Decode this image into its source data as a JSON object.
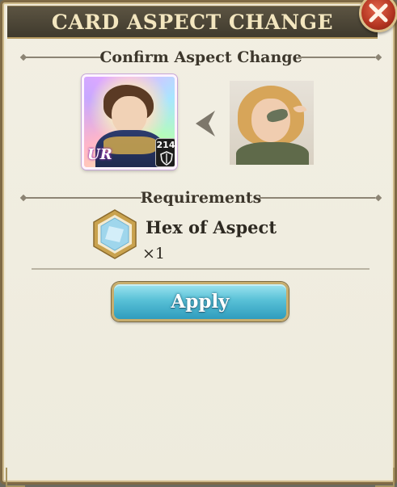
{
  "header": {
    "title": "CARD ASPECT CHANGE"
  },
  "confirm_section": {
    "title": "Confirm Aspect Change"
  },
  "current_card": {
    "rarity_label": "UR",
    "level": "214"
  },
  "requirements_section": {
    "title": "Requirements"
  },
  "requirement": {
    "item_name": "Hex of Aspect",
    "quantity": "×1"
  },
  "apply_button": {
    "label": "Apply"
  },
  "colors": {
    "accent": "#f3e6bf",
    "button": "#59c1d7",
    "close": "#b23420"
  },
  "icons": {
    "close": "close-icon",
    "arrow": "chevron-left-icon",
    "shield": "shield-icon",
    "hex": "hex-crystal-icon"
  }
}
